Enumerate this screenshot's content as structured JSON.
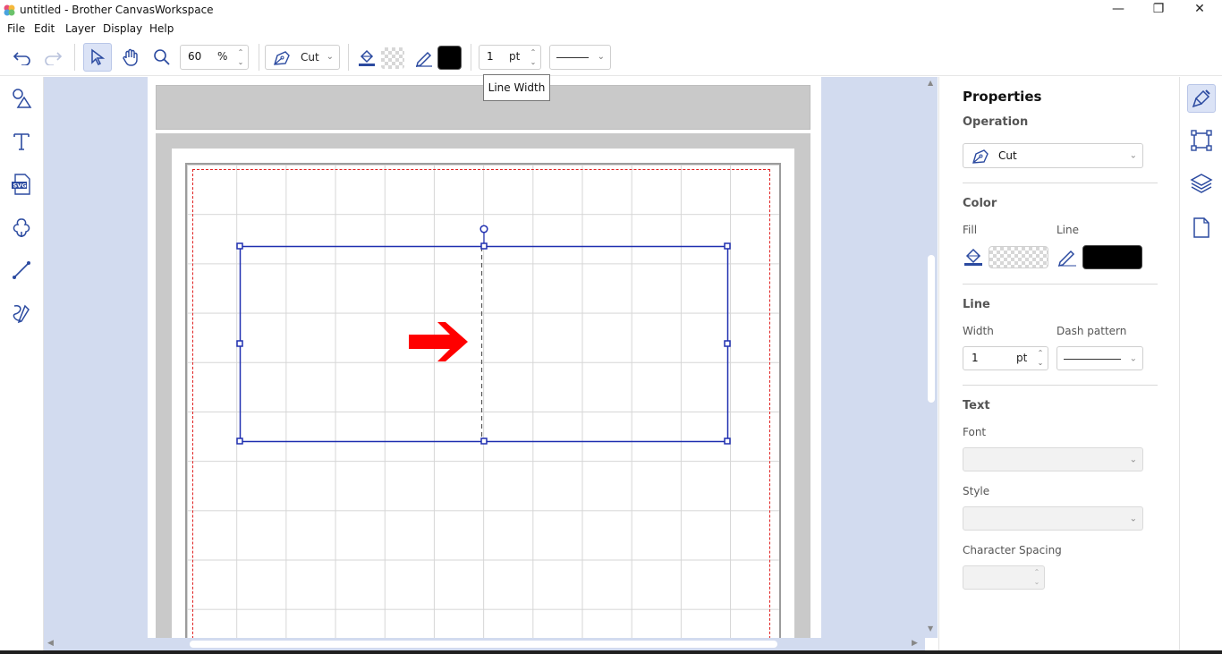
{
  "window": {
    "title": "untitled - Brother CanvasWorkspace",
    "minimize_glyph": "—",
    "restore_glyph": "❐",
    "close_glyph": "✕"
  },
  "menu": [
    "File",
    "Edit",
    "Layer",
    "Display",
    "Help"
  ],
  "toolbar": {
    "zoom_value": "60",
    "zoom_unit": "%",
    "operation_label": "Cut",
    "line_width_value": "1",
    "line_width_unit": "pt",
    "line_color": "#000000"
  },
  "tooltip": "Line Width",
  "properties": {
    "title": "Properties",
    "operation_section": "Operation",
    "operation_value": "Cut",
    "color_section": "Color",
    "fill_label": "Fill",
    "line_label": "Line",
    "line_color": "#000000",
    "line_section": "Line",
    "width_label": "Width",
    "width_value": "1",
    "width_unit": "pt",
    "dash_label": "Dash pattern",
    "text_section": "Text",
    "font_label": "Font",
    "style_label": "Style",
    "spacing_label": "Character Spacing"
  },
  "icons": {
    "left_rail": [
      "shapes-icon",
      "text-icon",
      "svg-import-icon",
      "shape-library-icon",
      "line-draw-icon",
      "freehand-icon"
    ],
    "right_rail": [
      "properties-brush-icon",
      "transform-icon",
      "layers-icon",
      "page-icon"
    ]
  },
  "colors": {
    "accent": "#2b4aa0",
    "canvas_bg": "#d2dbef",
    "selection": "#1f2fb0",
    "arrow": "#ff0000",
    "cut_border": "#e02020"
  }
}
